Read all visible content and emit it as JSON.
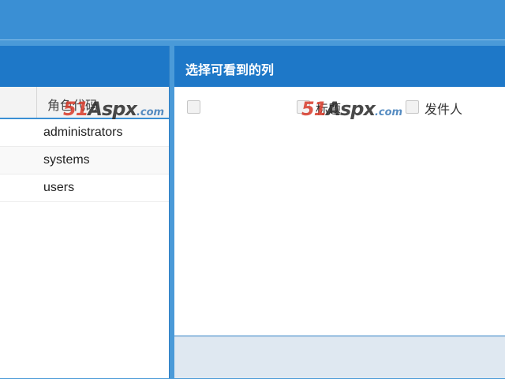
{
  "right_panel": {
    "title": "选择可看到的列",
    "checkboxes": [
      {
        "label": "",
        "checked": false
      },
      {
        "label": "标题",
        "checked": false
      },
      {
        "label": "发件人",
        "checked": false
      }
    ]
  },
  "left_panel": {
    "column_header": "角色代码",
    "rows": [
      "administrators",
      "systems",
      "users"
    ]
  },
  "watermark": {
    "number": "51",
    "brand": "Aspx",
    "suffix": ".com"
  },
  "colors": {
    "accent": "#1e78c8",
    "background": "#3a8fd4",
    "watermark_red": "#d83a2a"
  }
}
